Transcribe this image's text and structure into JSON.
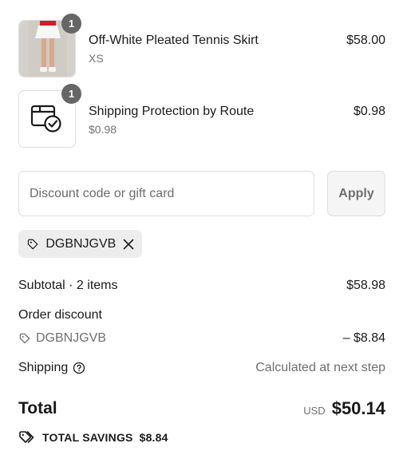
{
  "line_items": [
    {
      "name": "Off-White Pleated Tennis Skirt",
      "variant": "XS",
      "price": "$58.00",
      "quantity": "1",
      "image": "tennis-skirt-photo"
    },
    {
      "name": "Shipping Protection by Route",
      "variant": "$0.98",
      "price": "$0.98",
      "quantity": "1",
      "image": "package-check-icon"
    }
  ],
  "discount": {
    "placeholder": "Discount code or gift card",
    "value": "",
    "apply_label": "Apply",
    "applied_code": "DGBNJGVB"
  },
  "summary": {
    "subtotal_label": "Subtotal · 2 items",
    "subtotal_value": "$58.98",
    "order_discount_label": "Order discount",
    "discount_code": "DGBNJGVB",
    "discount_value": "– $8.84",
    "shipping_label": "Shipping",
    "shipping_value": "Calculated at next step",
    "total_label": "Total",
    "currency": "USD",
    "total_value": "$50.14",
    "savings_label": "TOTAL SAVINGS",
    "savings_value": "$8.84"
  },
  "colors": {
    "text": "#1a1a1a",
    "muted": "#707070",
    "border": "#dedede",
    "badge": "#666666",
    "chip_bg": "#ededed"
  }
}
